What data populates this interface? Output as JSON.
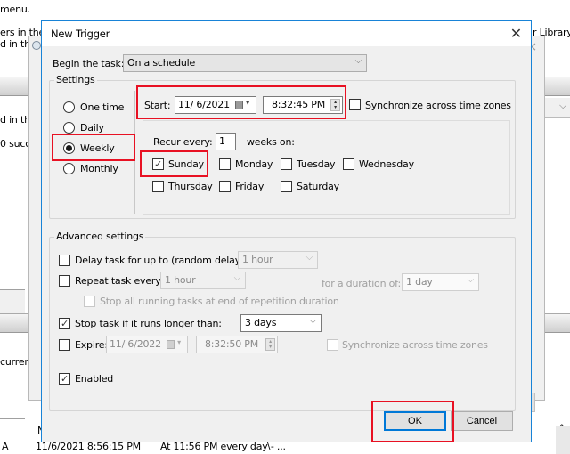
{
  "background": {
    "text_top": "menu.",
    "text_line2": "ers in the T",
    "text_line3": "d in th",
    "text_right": "r Library",
    "text_side1": "d in th",
    "text_side2": "0 succ",
    "text_side3": "curren",
    "bottom_row": {
      "col1": "A",
      "col2": "11/6/2021 8:56:15 PM",
      "col3": "At 11:56 PM every day - ...",
      "col4": "\\",
      "header_fragment": "N"
    },
    "behind_dialog_close": "×"
  },
  "dialog": {
    "title": "New Trigger",
    "close_glyph": "✕",
    "begin_task": {
      "label": "Begin the task:",
      "value": "On a schedule",
      "arrow": "⌵"
    },
    "settings": {
      "group_label": "Settings",
      "schedule_options": [
        {
          "label": "One time",
          "checked": false
        },
        {
          "label": "Daily",
          "checked": false
        },
        {
          "label": "Weekly",
          "checked": true
        },
        {
          "label": "Monthly",
          "checked": false
        }
      ],
      "start_label": "Start:",
      "start_date": "11/  6/2021",
      "start_time": "8:32:45 PM",
      "sync_label": "Synchronize across time zones",
      "sync_checked": false,
      "recur_label": "Recur every:",
      "recur_value": "1",
      "weeks_on_label": "weeks on:",
      "days": [
        {
          "label": "Sunday",
          "checked": true
        },
        {
          "label": "Monday",
          "checked": false
        },
        {
          "label": "Tuesday",
          "checked": false
        },
        {
          "label": "Wednesday",
          "checked": false
        },
        {
          "label": "Thursday",
          "checked": false
        },
        {
          "label": "Friday",
          "checked": false
        },
        {
          "label": "Saturday",
          "checked": false
        }
      ]
    },
    "advanced": {
      "group_label": "Advanced settings",
      "delay_label": "Delay task for up to (random delay):",
      "delay_checked": false,
      "delay_value": "1 hour",
      "repeat_label": "Repeat task every:",
      "repeat_checked": false,
      "repeat_value": "1 hour",
      "duration_label": "for a duration of:",
      "duration_value": "1 day",
      "stop_all_label": "Stop all running tasks at end of repetition duration",
      "stop_all_checked": false,
      "stop_longer_label": "Stop task if it runs longer than:",
      "stop_longer_checked": true,
      "stop_longer_value": "3 days",
      "expire_label": "Expire:",
      "expire_checked": false,
      "expire_date": "11/  6/2022",
      "expire_time": "8:32:50 PM",
      "expire_sync_label": "Synchronize across time zones",
      "expire_sync_checked": false,
      "enabled_label": "Enabled",
      "enabled_checked": true
    },
    "buttons": {
      "ok": "OK",
      "cancel": "Cancel"
    }
  },
  "highlight_color": "#e81123",
  "accent_color": "#0078d7"
}
